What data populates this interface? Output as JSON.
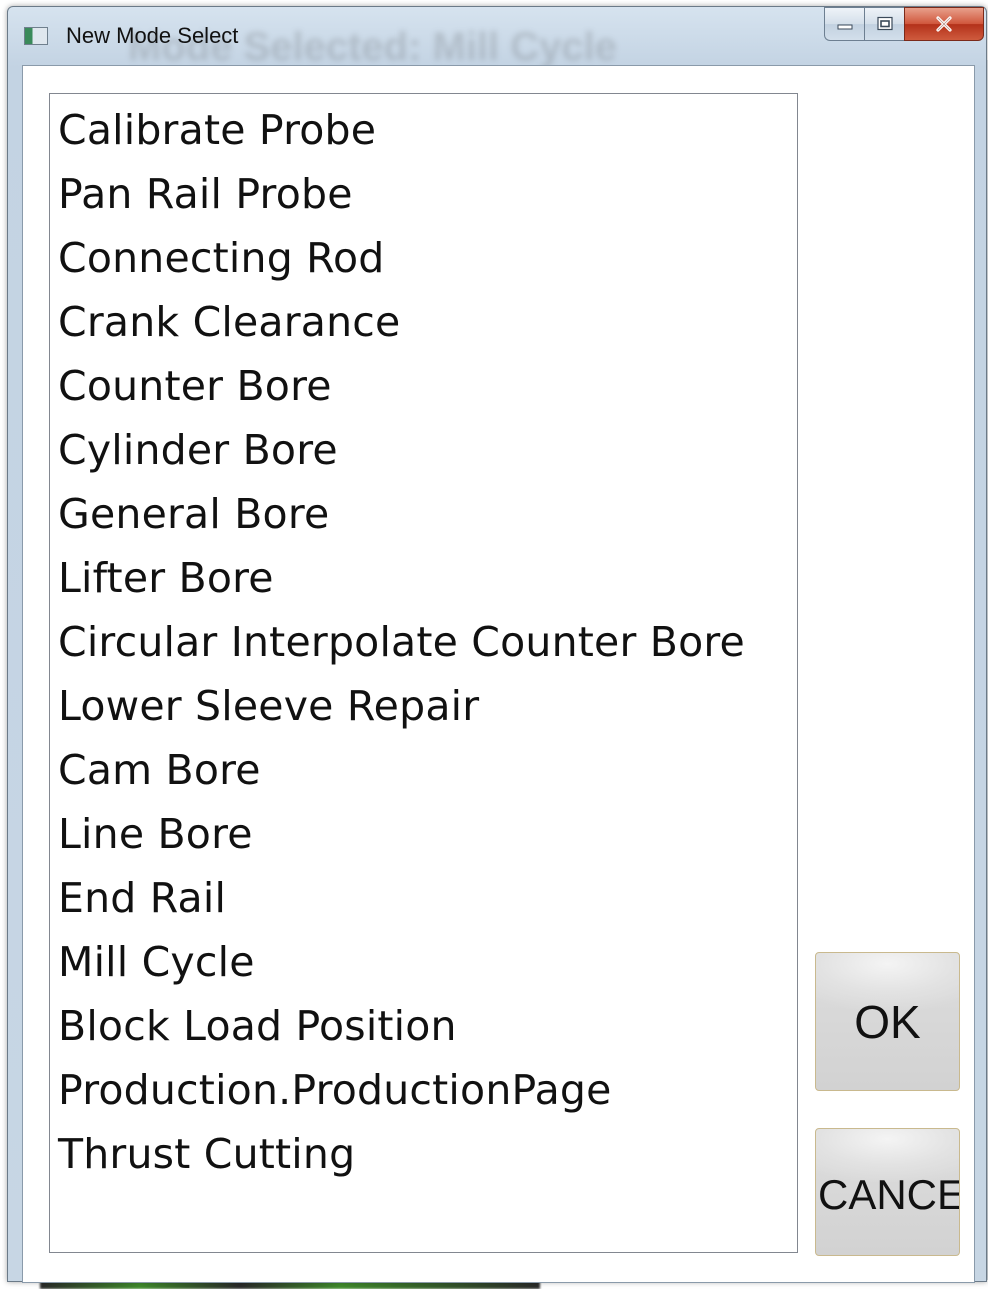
{
  "window": {
    "title": "New Mode Select",
    "background_title": "Mode Selected: Mill Cycle"
  },
  "list": {
    "items": [
      "Calibrate Probe",
      "Pan Rail Probe",
      "Connecting Rod",
      "Crank Clearance",
      "Counter Bore",
      "Cylinder Bore",
      "General Bore",
      "Lifter Bore",
      "Circular Interpolate Counter Bore",
      "Lower Sleeve Repair",
      "Cam Bore",
      "Line Bore",
      "End Rail",
      "Mill Cycle",
      "Block Load Position",
      "Production.ProductionPage",
      "Thrust Cutting"
    ]
  },
  "buttons": {
    "ok_label": "OK",
    "cancel_label": "CANCE"
  },
  "icons": {
    "app": "app-icon",
    "minimize": "minimize-icon",
    "maximize": "maximize-icon",
    "close": "close-icon"
  },
  "colors": {
    "close_button": "#c84a2e",
    "button_border": "#c9b98e",
    "button_face": "#d8d8d8"
  }
}
